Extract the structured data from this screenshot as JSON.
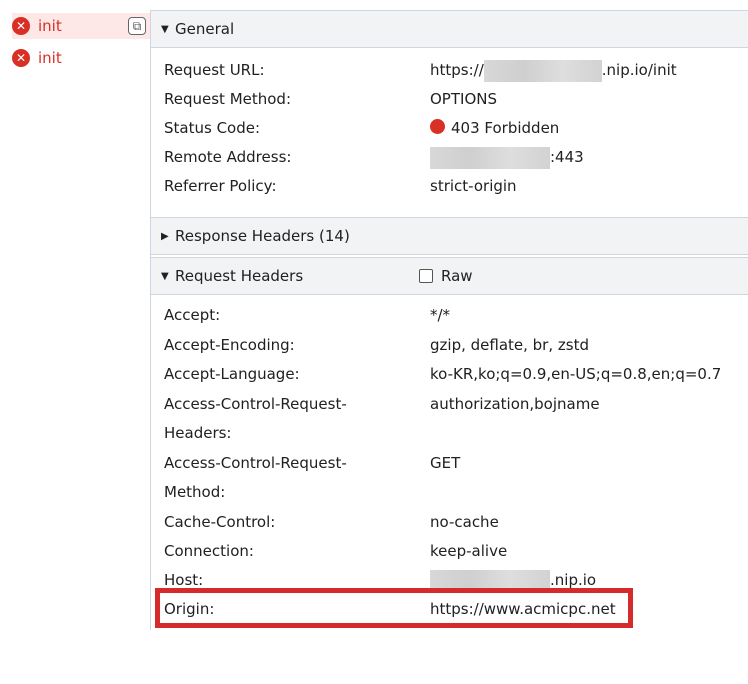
{
  "request_list": [
    {
      "name": "init",
      "selected": true
    },
    {
      "name": "init",
      "selected": false
    }
  ],
  "icons": {
    "error": "error-circle-icon",
    "copy": "copy-icon",
    "expand": "triangle-icon"
  },
  "colors": {
    "error": "#d93025",
    "highlight": "#d62b2b",
    "header_bg": "#f1f3f4"
  },
  "general": {
    "title": "General",
    "rows": [
      {
        "key": "Request URL:",
        "value_prefix": "https://",
        "value_suffix": ".nip.io/init"
      },
      {
        "key": "Request Method:",
        "value": "OPTIONS"
      },
      {
        "key": "Status Code:",
        "value": "403 Forbidden"
      },
      {
        "key": "Remote Address:",
        "value_suffix": ":443"
      },
      {
        "key": "Referrer Policy:",
        "value": "strict-origin"
      }
    ]
  },
  "response_headers": {
    "title": "Response Headers (14)"
  },
  "request_headers": {
    "title": "Request Headers",
    "raw_label": "Raw",
    "rows": [
      {
        "key": "Accept:",
        "value": "*/*"
      },
      {
        "key": "Accept-Encoding:",
        "value": "gzip, deflate, br, zstd"
      },
      {
        "key": "Accept-Language:",
        "value": "ko-KR,ko;q=0.9,en-US;q=0.8,en;q=0.7"
      },
      {
        "key": "Access-Control-Request-",
        "key2": "Headers:",
        "value": "authorization,bojname"
      },
      {
        "key": "Access-Control-Request-",
        "key2": "Method:",
        "value": "GET"
      },
      {
        "key": "Cache-Control:",
        "value": "no-cache"
      },
      {
        "key": "Connection:",
        "value": "keep-alive"
      },
      {
        "key": "Host:",
        "value_suffix": ".nip.io"
      },
      {
        "key": "Origin:",
        "value": "https://www.acmicpc.net"
      }
    ]
  }
}
